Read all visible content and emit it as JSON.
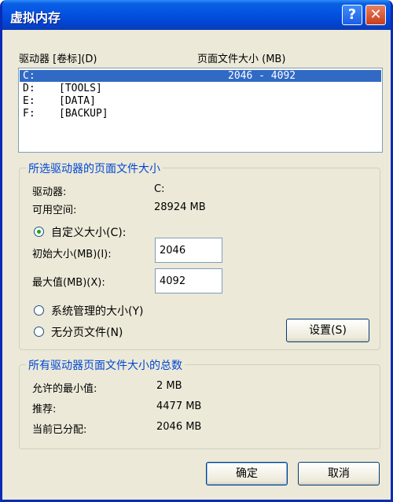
{
  "window": {
    "title": "虚拟内存"
  },
  "list": {
    "header_drive": "驱动器 [卷标](D)",
    "header_size": "页面文件大小 (MB)",
    "rows": [
      {
        "drive": "C:",
        "label": "",
        "size": "2046 - 4092"
      },
      {
        "drive": "D:",
        "label": "[TOOLS]",
        "size": ""
      },
      {
        "drive": "E:",
        "label": "[DATA]",
        "size": ""
      },
      {
        "drive": "F:",
        "label": "[BACKUP]",
        "size": ""
      }
    ]
  },
  "selected": {
    "group_title": "所选驱动器的页面文件大小",
    "drive_label": "驱动器:",
    "drive_value": "C:",
    "space_label": "可用空间:",
    "space_value": "28924 MB",
    "custom_label": "自定义大小(C):",
    "initial_label": "初始大小(MB)(I):",
    "initial_value": "2046",
    "max_label": "最大值(MB)(X):",
    "max_value": "4092",
    "system_label": "系统管理的大小(Y)",
    "nopage_label": "无分页文件(N)",
    "set_button": "设置(S)"
  },
  "total": {
    "group_title": "所有驱动器页面文件大小的总数",
    "min_label": "允许的最小值:",
    "min_value": "2 MB",
    "rec_label": "推荐:",
    "rec_value": "4477 MB",
    "cur_label": "当前已分配:",
    "cur_value": "2046 MB"
  },
  "buttons": {
    "ok": "确定",
    "cancel": "取消"
  },
  "icons": {
    "help": "question-mark",
    "close": "x-close"
  },
  "colors": {
    "titlebar": "#0554e3",
    "selection": "#316ac5",
    "group_title": "#0046d5"
  }
}
